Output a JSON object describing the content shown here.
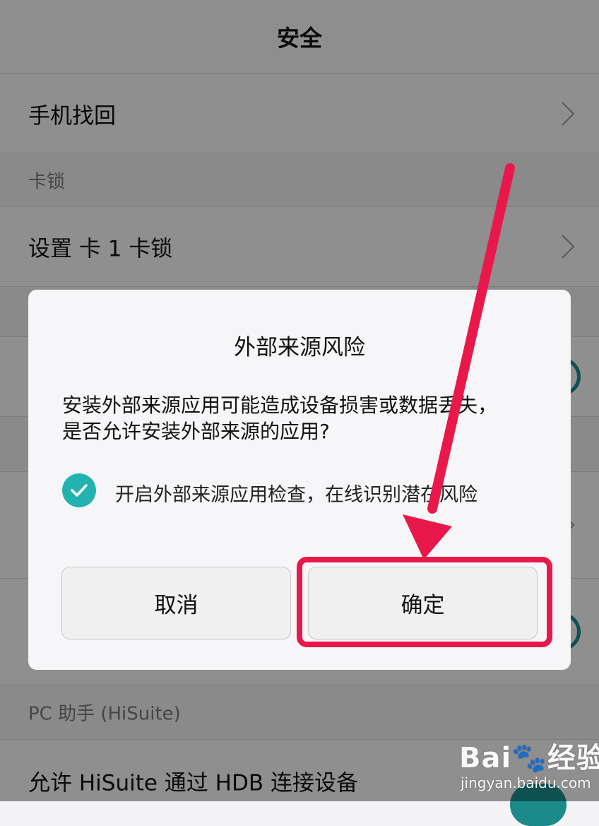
{
  "header": {
    "title": "安全"
  },
  "rows": {
    "phone_find": "手机找回",
    "section_card_lock": "卡锁",
    "set_card_lock": "设置 卡 1 卡锁",
    "section_pc_assistant": "PC 助手 (HiSuite)",
    "allow_hisuite": "允许 HiSuite 通过 HDB 连接设备"
  },
  "dialog": {
    "title": "外部来源风险",
    "message": "安装外部来源应用可能造成设备损害或数据丢失，是否允许安装外部来源的应用?",
    "checkbox_label": "开启外部来源应用检查，在线识别潜在风险",
    "checkbox_checked": true,
    "cancel_label": "取消",
    "confirm_label": "确定"
  },
  "colors": {
    "accent": "#22b3b0",
    "toggle": "#1a8a8a",
    "annotation": "#e8194a"
  },
  "watermark": {
    "logo": "Bai🐾经验",
    "url": "jingyan.baidu.com"
  }
}
